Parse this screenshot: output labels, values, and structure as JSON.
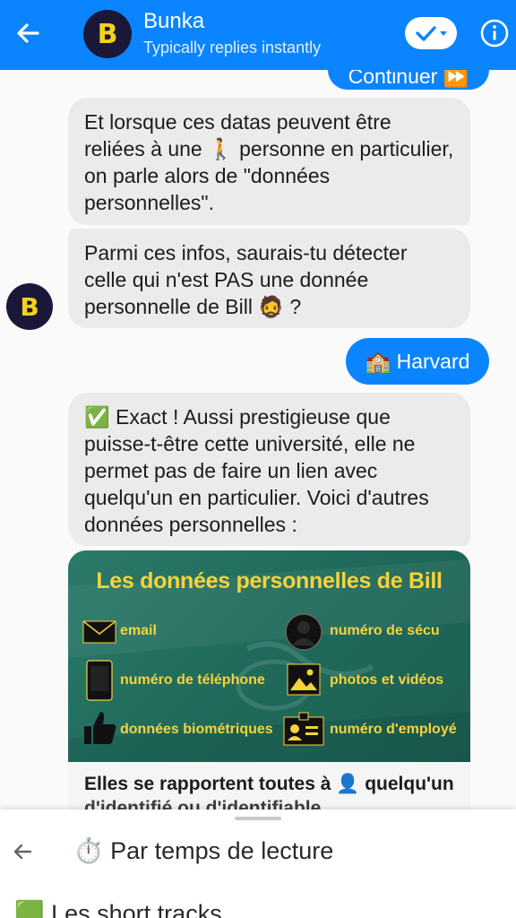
{
  "header": {
    "avatar_letter": "B",
    "bot_name": "Bunka",
    "status": "Typically replies instantly"
  },
  "chat": {
    "continue_button": "Continuer ⏩",
    "message1": "Et lorsque ces datas peuvent être reliées à une 🚶 personne en particulier, on parle alors de \"données personnelles\".",
    "message2": "Parmi ces infos, saurais-tu détecter celle qui n'est PAS une donnée personnelle de Bill 🧔 ?",
    "avatar_letter": "B",
    "reply": "🏫 Harvard",
    "message3": "✅ Exact ! Aussi prestigieuse que puisse-t-être cette université, elle ne permet pas de faire un lien avec quelqu'un en particulier. Voici d'autres données personnelles :"
  },
  "card": {
    "title": "Les données personnelles de Bill",
    "items": [
      {
        "label": "email",
        "icon": "envelope-icon"
      },
      {
        "label": "numéro de sécu",
        "icon": "person-silhouette-icon"
      },
      {
        "label": "numéro de téléphone",
        "icon": "phone-icon"
      },
      {
        "label": "photos et vidéos",
        "icon": "image-icon"
      },
      {
        "label": "données biométriques",
        "icon": "thumbs-up-icon"
      },
      {
        "label": "numéro d'employé",
        "icon": "id-badge-icon"
      }
    ],
    "caption": "Elles se rapportent toutes à 👤 quelqu'un",
    "caption_cut": "d'identifié ou d'identifiable"
  },
  "sheet": {
    "title": "⏱️ Par temps de lecture",
    "item": "🟩 Les short tracks"
  },
  "colors": {
    "brand_blue": "#0b84ff",
    "card_green": "#1f6b5c",
    "card_yellow": "#f6d33a",
    "avatar_bg": "#1a1838"
  }
}
